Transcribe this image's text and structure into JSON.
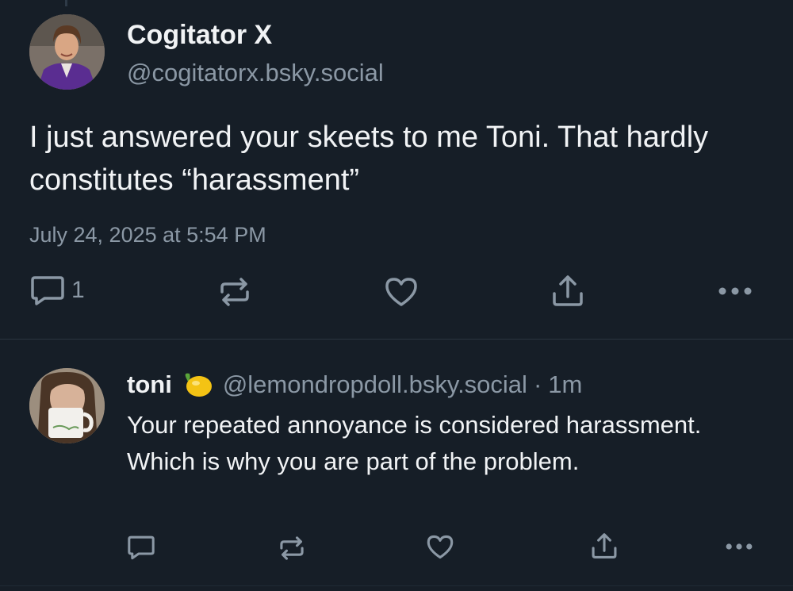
{
  "main_post": {
    "author_name": "Cogitator X",
    "author_handle": "@cogitatorx.bsky.social",
    "text": "I just answered your skeets to me Toni. That hardly constitutes “harassment”",
    "date": "July 24, 2025 at 5:54 PM",
    "reply_count": "1",
    "actions": [
      "reply-icon",
      "repost-icon",
      "like-icon",
      "share-icon",
      "more-icon"
    ]
  },
  "reply_post": {
    "author_name": "toni",
    "author_emoji": "lemon-icon",
    "author_handle": "@lemondropdoll.bsky.social",
    "separator": "·",
    "time": "1m",
    "text": "Your repeated annoyance is considered harassment. Which is why you are part of the problem.",
    "actions": [
      "reply-icon",
      "repost-icon",
      "like-icon",
      "share-icon",
      "more-icon"
    ]
  },
  "colors": {
    "background": "#161e27",
    "text_primary": "#f1f3f5",
    "text_secondary": "#8b98a5",
    "divider": "#2a3540"
  }
}
